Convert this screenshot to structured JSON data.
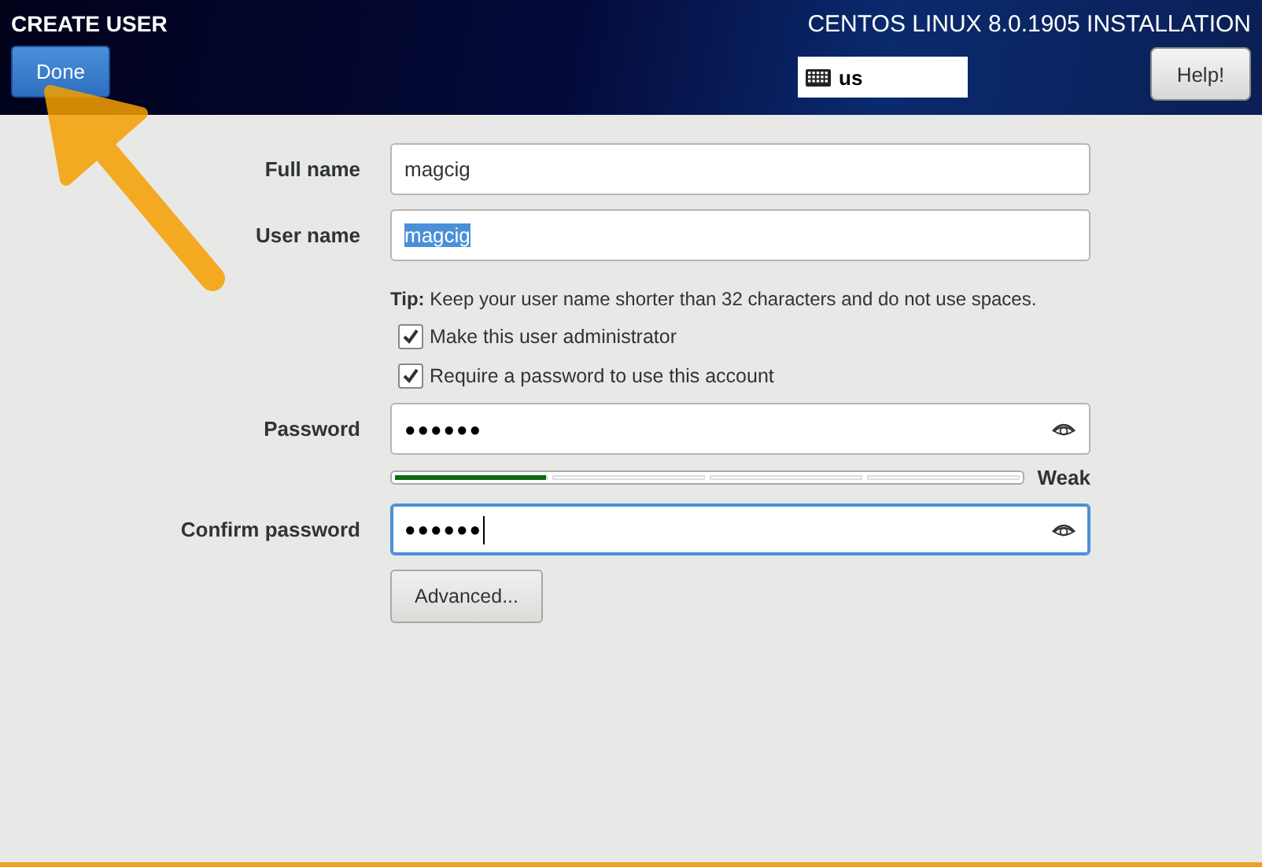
{
  "header": {
    "title": "CREATE USER",
    "done_button": "Done",
    "product": "CENTOS LINUX 8.0.1905 INSTALLATION",
    "keyboard_layout": "us",
    "help_button": "Help!"
  },
  "form": {
    "full_name": {
      "label": "Full name",
      "value": "magcig",
      "selected": false,
      "focused": false
    },
    "user_name": {
      "label": "User name",
      "value": "magcig",
      "selected": true,
      "focused": false
    },
    "tip": "**Tip:** Keep your user name shorter than 32 characters and do not use spaces.",
    "checkboxes": [
      {
        "label": "Make this user administrator",
        "checked": true
      },
      {
        "label": "Require a password to use this account",
        "checked": true
      }
    ],
    "password": {
      "label": "Password",
      "value": "●●●●●●",
      "focused": false
    },
    "strength": {
      "level": 0.25,
      "label": "Weak"
    },
    "confirm_password": {
      "label": "Confirm password",
      "value": "●●●●●●",
      "focused": true
    },
    "advanced_button": "Advanced..."
  },
  "annotation": {
    "kind": "arrow"
  }
}
